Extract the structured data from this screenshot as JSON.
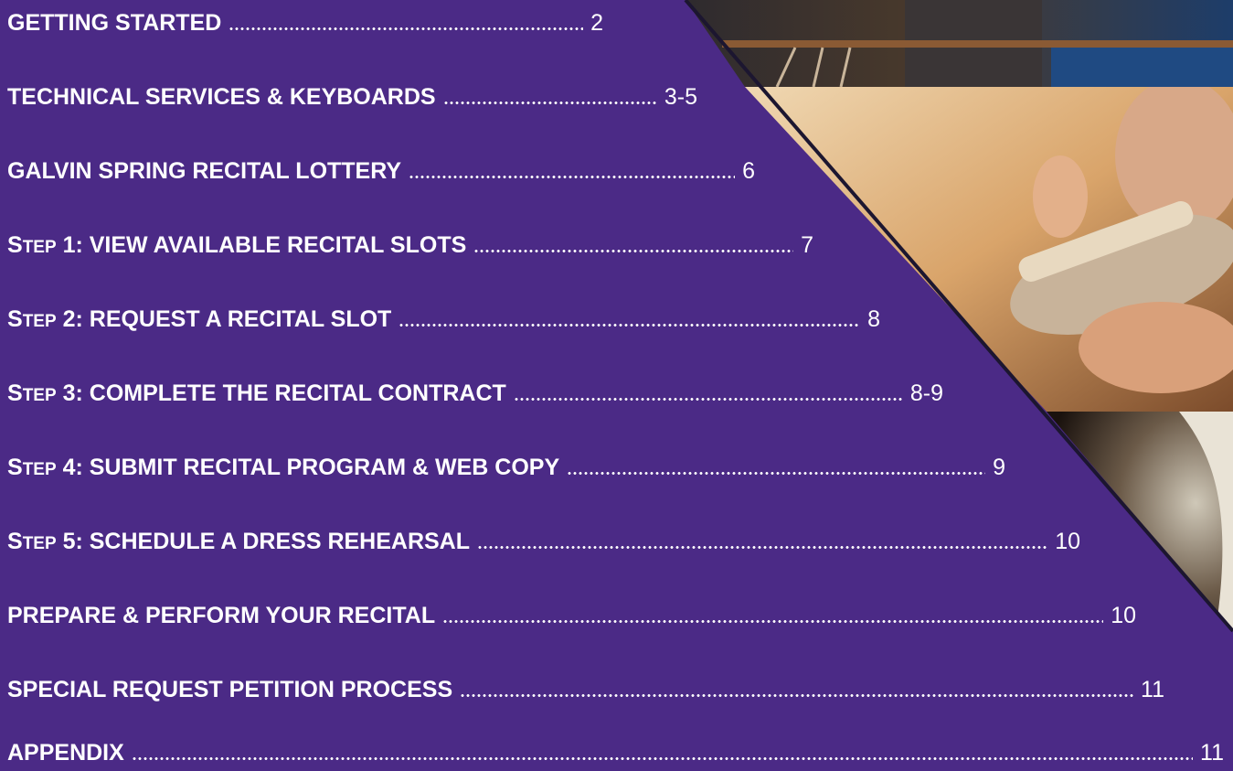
{
  "colors": {
    "background": "#4b2a86",
    "text": "#ffffff",
    "edge": "#1c1630"
  },
  "photos": [
    {
      "name": "conductor-photo",
      "description_icon": "concert-hall-photo"
    },
    {
      "name": "trumpet-player-photo",
      "description_icon": "trumpet-photo"
    },
    {
      "name": "performer-hair-photo",
      "description_icon": "portrait-photo"
    }
  ],
  "toc": {
    "items": [
      {
        "lead": "",
        "sc": "",
        "title": "GETTING STARTED",
        "page": "2"
      },
      {
        "lead": "",
        "sc": "",
        "title": "TECHNICAL SERVICES & KEYBOARDS",
        "page": "3-5"
      },
      {
        "lead": "",
        "sc": "",
        "title": "GALVIN SPRING RECITAL LOTTERY",
        "page": "6"
      },
      {
        "lead": "S",
        "sc": "TEP",
        "title": " 1: VIEW AVAILABLE RECITAL SLOTS",
        "page": "7"
      },
      {
        "lead": "S",
        "sc": "TEP",
        "title": " 2: REQUEST A RECITAL SLOT",
        "page": "8"
      },
      {
        "lead": "S",
        "sc": "TEP",
        "title": " 3: COMPLETE THE RECITAL CONTRACT",
        "page": "8-9"
      },
      {
        "lead": "S",
        "sc": "TEP",
        "title": " 4: SUBMIT RECITAL PROGRAM & WEB COPY",
        "page": "9"
      },
      {
        "lead": "S",
        "sc": "TEP",
        "title": " 5: SCHEDULE A DRESS REHEARSAL",
        "page": "10"
      },
      {
        "lead": "",
        "sc": "",
        "title": "PREPARE & PERFORM YOUR RECITAL",
        "page": "10"
      },
      {
        "lead": "",
        "sc": "",
        "title": "SPECIAL REQUEST PETITION PROCESS",
        "page": "11"
      },
      {
        "lead": "",
        "sc": "",
        "title": "APPENDIX",
        "page": "11"
      }
    ]
  }
}
